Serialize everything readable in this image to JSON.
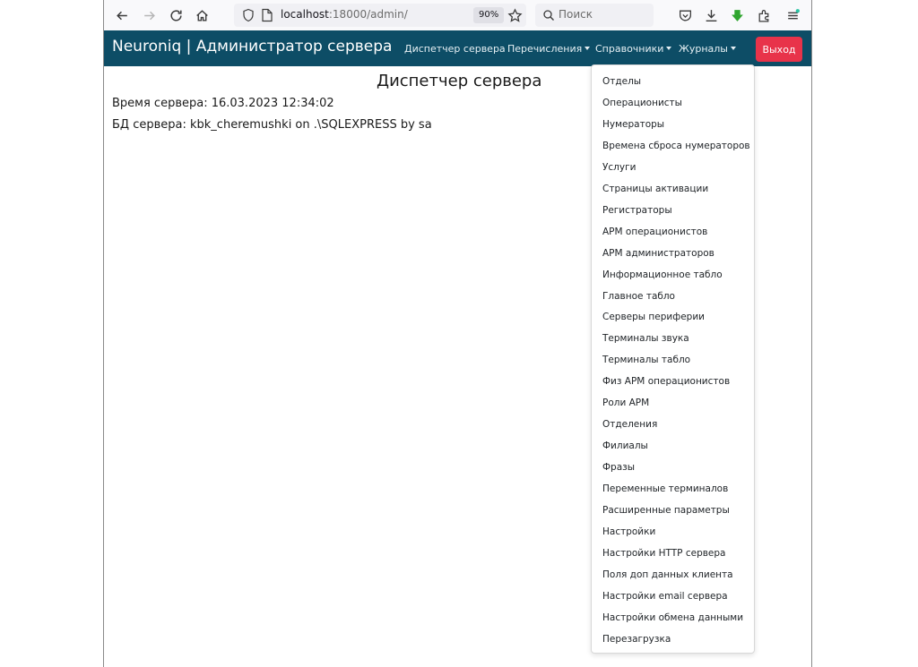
{
  "browser": {
    "url_host": "localhost",
    "url_rest": ":18000/admin/",
    "zoom": "90%",
    "search_placeholder": "Поиск"
  },
  "navbar": {
    "brand": "Neuroniq | Администратор сервера",
    "links": [
      {
        "label": "Диспетчер сервера",
        "dropdown": false
      },
      {
        "label": "Перечисления",
        "dropdown": true
      },
      {
        "label": "Справочники",
        "dropdown": true
      },
      {
        "label": "Журналы",
        "dropdown": true
      }
    ],
    "logout_label": "Выход"
  },
  "main": {
    "title": "Диспетчер сервера",
    "server_time": "Время сервера: 16.03.2023 12:34:02",
    "server_db": "БД сервера: kbk_cheremushki on .\\SQLEXPRESS by sa"
  },
  "dropdown": {
    "items": [
      "Отделы",
      "Операционисты",
      "Нумераторы",
      "Времена сброса нумераторов",
      "Услуги",
      "Страницы активации",
      "Регистраторы",
      "АРМ операционистов",
      "АРМ администраторов",
      "Информационное табло",
      "Главное табло",
      "Серверы периферии",
      "Терминалы звука",
      "Терминалы табло",
      "Физ АРМ операционистов",
      "Роли АРМ",
      "Отделения",
      "Филиалы",
      "Фразы",
      "Переменные терминалов",
      "Расширенные параметры",
      "Настройки",
      "Настройки HTTP сервера",
      "Поля доп данных клиента",
      "Настройки email сервера",
      "Настройки обмена данными",
      "Перезагрузка"
    ]
  },
  "colors": {
    "navbar": "#0d4d66",
    "logout": "#e8334a"
  }
}
